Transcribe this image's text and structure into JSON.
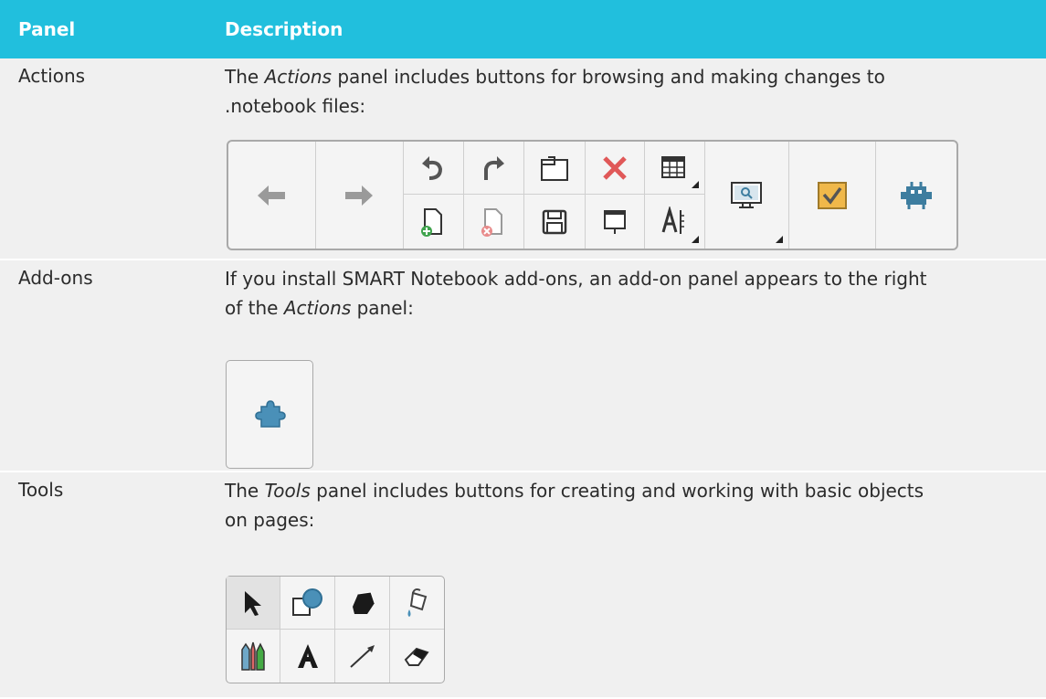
{
  "header": {
    "col1": "Panel",
    "col2": "Description"
  },
  "rows": [
    {
      "panel": "Actions",
      "desc_line1_pre": "The ",
      "desc_line1_em": "Actions",
      "desc_line1_post": " panel includes buttons for browsing and making changes to",
      "desc_line2": ".notebook files:"
    },
    {
      "panel": "Add-ons",
      "desc_line1": "If you install SMART Notebook add-ons, an add-on panel appears to the right",
      "desc_line2_pre": "of the ",
      "desc_line2_em": "Actions",
      "desc_line2_post": " panel:"
    },
    {
      "panel": "Tools",
      "desc_line1_pre": "The ",
      "desc_line1_em": "Tools",
      "desc_line1_post": " panel includes buttons for creating and working with basic objects",
      "desc_line2": "on pages:"
    }
  ],
  "actions_toolbar": {
    "icons": [
      "back-arrow-icon",
      "forward-arrow-icon",
      "undo-icon",
      "redo-icon",
      "paste-icon",
      "delete-icon",
      "table-icon",
      "add-page-icon",
      "delete-page-icon",
      "save-icon",
      "screen-shade-icon",
      "properties-icon",
      "screen-capture-icon",
      "response-icon",
      "smart-lab-icon"
    ]
  },
  "addons_panel": {
    "icons": [
      "puzzle-icon"
    ]
  },
  "tools_panel": {
    "icons": [
      "select-icon",
      "shapes-icon",
      "regular-polygon-icon",
      "fill-icon",
      "pens-icon",
      "text-icon",
      "lines-icon",
      "eraser-icon"
    ]
  },
  "colors": {
    "header_bg": "#21bfdd",
    "row_bg": "#f0f0f0",
    "icon_blue": "#3d7d9f",
    "delete_red": "#e05858",
    "response_orange": "#f0b84a"
  }
}
